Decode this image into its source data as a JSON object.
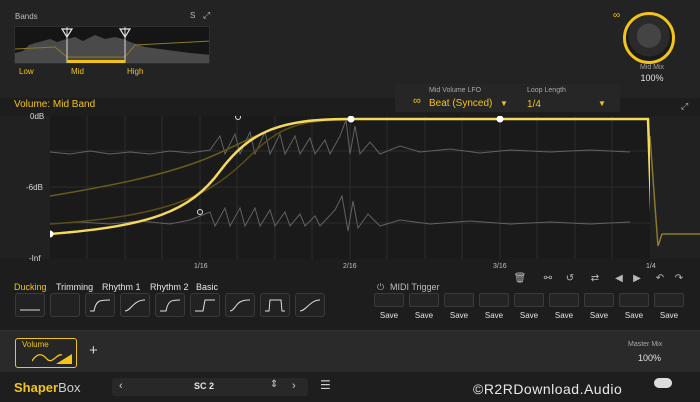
{
  "bands": {
    "title": "Bands",
    "s_label": "S",
    "low": "Low",
    "mid": "Mid",
    "high": "High"
  },
  "mid_mix": {
    "label": "Mid Mix",
    "value": "100%"
  },
  "volume_title": "Volume: Mid Band",
  "lfo": {
    "label": "Mid Volume LFO",
    "value": "Beat (Synced)"
  },
  "loop": {
    "label": "Loop Length",
    "value": "1/4"
  },
  "graph": {
    "y_labels": [
      "0dB",
      "-6dB",
      "-Inf"
    ],
    "x_labels": [
      "1/16",
      "2/16",
      "3/16",
      "1/4"
    ]
  },
  "presets": {
    "categories": [
      "Ducking",
      "Trimming",
      "Rhythm 1",
      "Rhythm 2",
      "Basic"
    ]
  },
  "midi_trigger": {
    "label": "MIDI Trigger",
    "save_label": "Save"
  },
  "tabs": {
    "volume": "Volume"
  },
  "master_mix": {
    "label": "Master Mix",
    "value": "100%"
  },
  "footer": {
    "logo_a": "Shaper",
    "logo_b": "Box",
    "preset": "SC 2",
    "watermark": "©R2RDownload.Audio"
  },
  "colors": {
    "accent": "#f2c41a",
    "background": "#1d1d1d"
  },
  "icons": [
    "link-icon",
    "expand-icon",
    "caret-down-icon",
    "power-icon",
    "trash-icon",
    "chain-icon",
    "curve-icon",
    "shuffle-icon",
    "arrow-left-icon",
    "arrow-right-icon",
    "undo-icon",
    "redo-icon",
    "plus-icon",
    "menu-icon",
    "updown-icon",
    "toggle-icon"
  ]
}
